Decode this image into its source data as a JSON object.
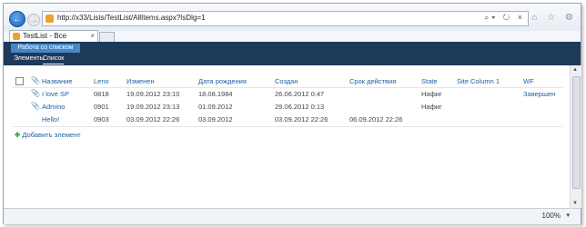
{
  "browser": {
    "url": "http://x33/Lists/TestList/AllItems.aspx?IsDlg=1",
    "tab_title": "TestList - Все элементы",
    "tab_close": "×",
    "addr_tools": "⌕▾ ↻ ×",
    "right_icons": "⌂ ☆ ⚙",
    "zoom": "100%",
    "zoom_arrow": "▾"
  },
  "ribbon": {
    "context_group": "Работа со списком",
    "tabs": [
      "Элементы",
      "Список"
    ]
  },
  "list": {
    "columns": [
      "Название",
      "Leno",
      "Изменен",
      "Дата рождения",
      "Создан",
      "Срок действия",
      "State",
      "Site Column 1",
      "WF"
    ],
    "rows": [
      {
        "title": "I love SP",
        "leno": "0818",
        "modified": "19.09.2012 23:10",
        "birth": "18.08.1984",
        "created": "26.06.2012 0:47",
        "expiry": "",
        "state": "Нафиг",
        "site_col": "",
        "wf": "Завершен"
      },
      {
        "title": "Admino",
        "leno": "0901",
        "modified": "19.09.2012 23:13",
        "birth": "01.09.2012",
        "created": "29.06.2012 0:13",
        "expiry": "",
        "state": "Нафиг",
        "site_col": "",
        "wf": ""
      },
      {
        "title": "Hello!",
        "leno": "0903",
        "modified": "03.09.2012 22:26",
        "birth": "03.09.2012",
        "created": "03.09.2012 22:26",
        "expiry": "06.09.2012 22:26",
        "state": "",
        "site_col": "",
        "wf": ""
      }
    ],
    "add_item": "Добавить элемент"
  },
  "icons": {
    "back": "back-arrow-icon",
    "forward": "forward-arrow-icon",
    "attachment": "paperclip-icon",
    "add": "plus-icon"
  },
  "colors": {
    "ribbon_bg": "#1e3a5a",
    "link": "#1d5fa8",
    "add_plus": "#3aa33a"
  }
}
